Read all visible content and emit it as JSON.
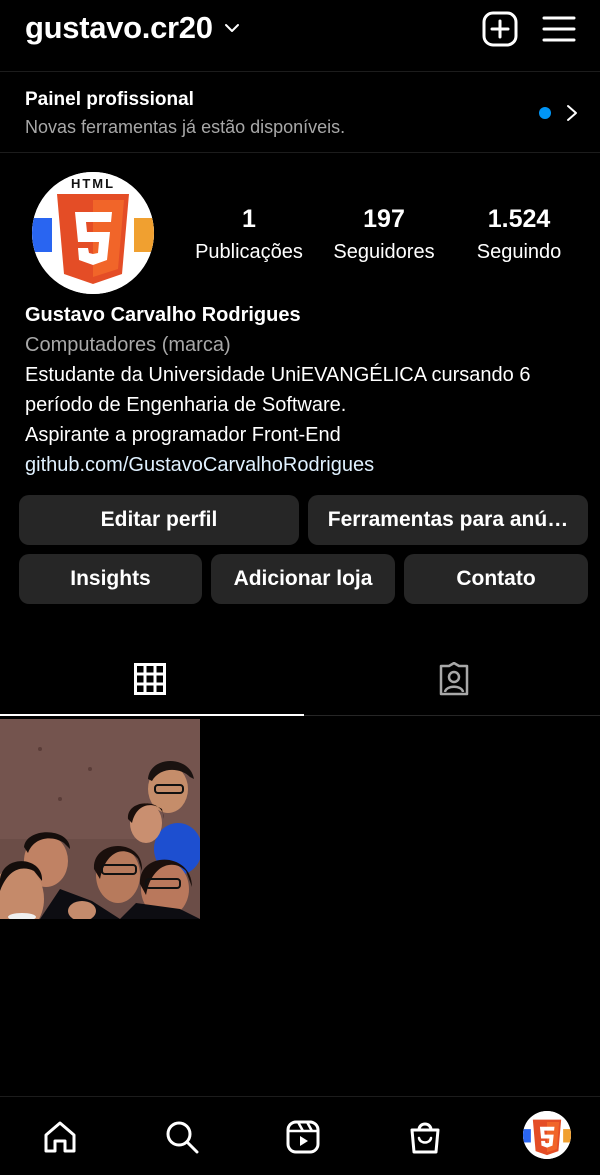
{
  "header": {
    "username": "gustavo.cr20",
    "icons": [
      "chevron-down-icon",
      "plus-square-icon",
      "menu-icon"
    ]
  },
  "panel": {
    "title": "Painel profissional",
    "subtitle": "Novas ferramentas já estão disponíveis.",
    "dot_color": "#0095f6"
  },
  "profile": {
    "stats": [
      {
        "num": "1",
        "label": "Publicações"
      },
      {
        "num": "197",
        "label": "Seguidores"
      },
      {
        "num": "1.524",
        "label": "Seguindo"
      }
    ],
    "name": "Gustavo Carvalho Rodrigues",
    "category": "Computadores (marca)",
    "bio_line1": "Estudante da Universidade UniEVANGÉLICA cursando 6",
    "bio_line2": "período de Engenharia de Software.",
    "bio_line3": "Aspirante a programador Front-End",
    "link": "github.com/GustavoCarvalhoRodrigues",
    "avatar_logo_text": "HTML",
    "avatar_logo_number": "5"
  },
  "buttons": {
    "edit_profile": "Editar perfil",
    "ad_tools": "Ferramentas para anú…",
    "insights": "Insights",
    "add_shop": "Adicionar loja",
    "contact": "Contato"
  },
  "tabs": {
    "active": "grid",
    "icons": [
      "grid-icon",
      "tagged-icon"
    ]
  },
  "bottom_nav": {
    "icons": [
      "home-icon",
      "search-icon",
      "reels-icon",
      "shop-icon",
      "profile-avatar"
    ]
  },
  "colors": {
    "background": "#000000",
    "button_bg": "#262626",
    "muted_text": "#a8a8a8",
    "accent": "#0095f6",
    "html5_orange": "#e44d26"
  }
}
